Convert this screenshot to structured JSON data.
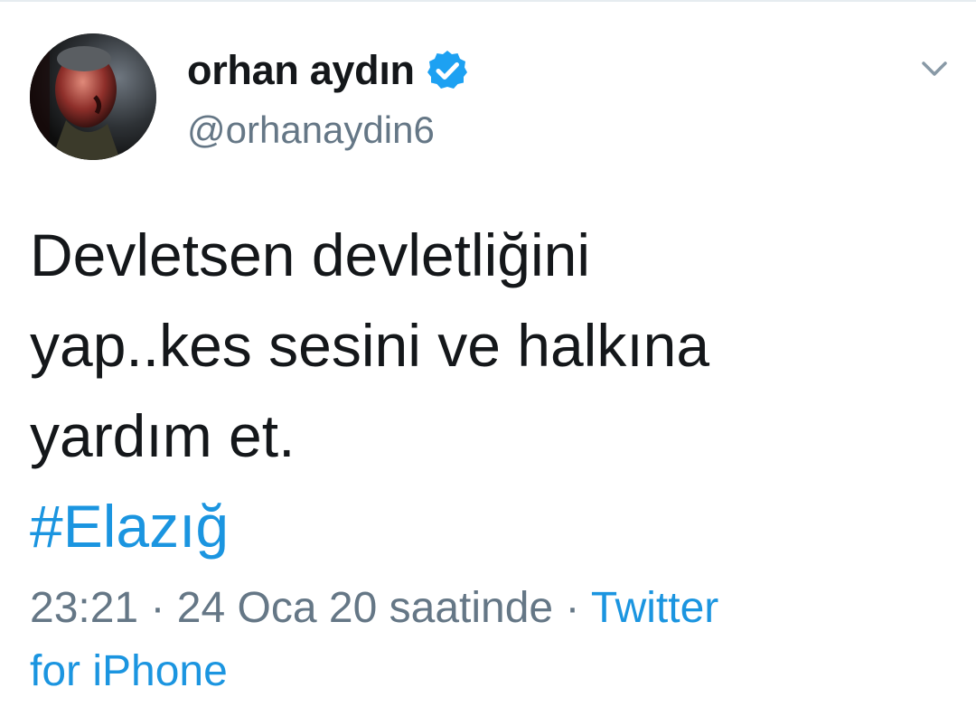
{
  "tweet": {
    "author": {
      "display_name": "orhan aydın",
      "handle": "@orhanaydin6",
      "verified": true,
      "avatar_icon": "avatar-photo"
    },
    "text_lines": [
      "Devletsen devletliğini",
      "yap..kes sesini ve halkına",
      "yardım et."
    ],
    "hashtag": "#Elazığ",
    "time": "23:21",
    "separator": "·",
    "date": "24 Oca 20 saatinde",
    "source_part1": "Twitter",
    "source_part2": "for iPhone",
    "menu_icon": "chevron-down-icon"
  },
  "colors": {
    "text": "#14171a",
    "secondary": "#657786",
    "link": "#1b95e0",
    "verified": "#1da1f2",
    "divider": "#e6ecf0"
  }
}
